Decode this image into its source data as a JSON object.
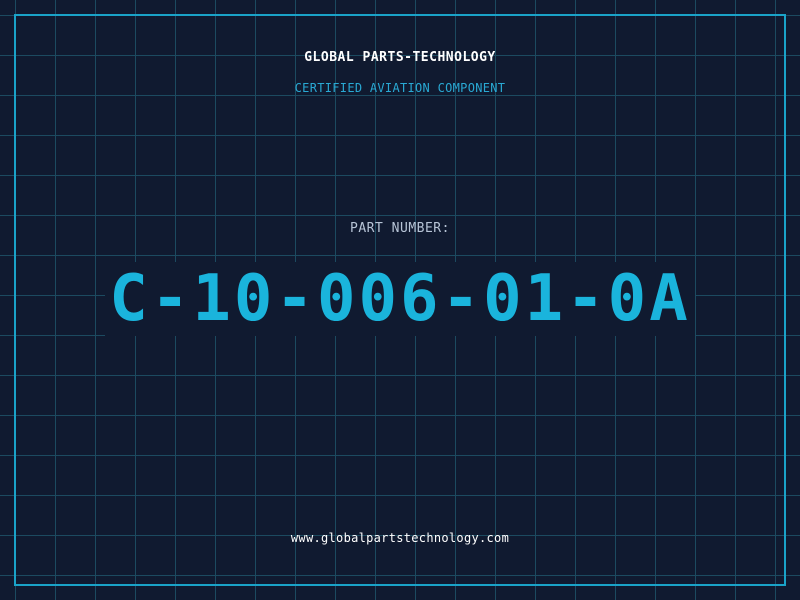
{
  "header": {
    "company_name": "GLOBAL PARTS-TECHNOLOGY",
    "certification": "CERTIFIED AVIATION COMPONENT"
  },
  "part": {
    "label": "PART NUMBER:",
    "number": "C-10-006-01-0A"
  },
  "footer": {
    "website": "www.globalpartstechnology.com"
  },
  "colors": {
    "background": "#101a30",
    "grid": "#1c4a60",
    "frame": "#1aa3c8",
    "accent": "#1ab4dc",
    "text": "#ffffff",
    "label": "#b7c4d6"
  }
}
